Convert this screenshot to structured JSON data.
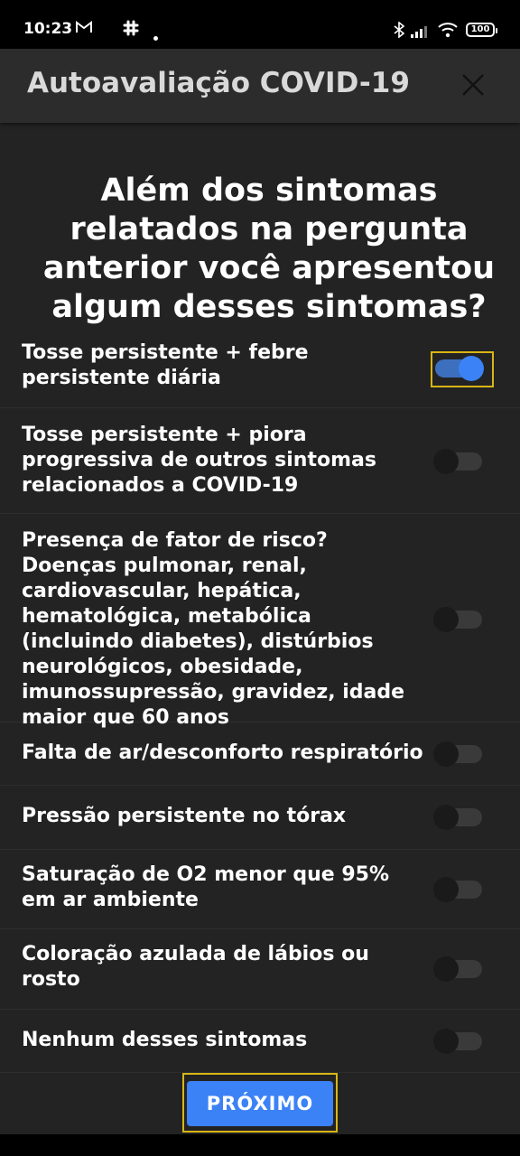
{
  "status_bar": {
    "time": "10:23",
    "battery": "100"
  },
  "app_bar": {
    "title": "Autoavaliação COVID-19",
    "close_icon": "close-icon"
  },
  "question": "Além dos sintomas relatados na pergunta anterior você apresentou algum desses sintomas?",
  "options": [
    {
      "label": "Tosse persistente + febre persistente diária",
      "checked": true
    },
    {
      "label": "Tosse persistente + piora progressiva de outros sintomas relacionados a COVID-19",
      "checked": false
    },
    {
      "label": "Presença de fator de risco? Doenças pulmonar, renal, cardiovascular, hepática, hematológica, metabólica (incluindo diabetes), distúrbios neurológicos, obesidade, imunossupressão, gravidez, idade maior que 60 anos",
      "checked": false
    },
    {
      "label": "Falta de ar/desconforto respiratório",
      "checked": false
    },
    {
      "label": "Pressão persistente no tórax",
      "checked": false
    },
    {
      "label": "Saturação de O2 menor que 95% em ar ambiente",
      "checked": false
    },
    {
      "label": "Coloração azulada de lábios ou rosto",
      "checked": false
    },
    {
      "label": "Nenhum desses sintomas",
      "checked": false
    }
  ],
  "next_button": "PRÓXIMO",
  "colors": {
    "accent": "#3b82f6",
    "focus": "#d8b516",
    "background": "#232323"
  }
}
